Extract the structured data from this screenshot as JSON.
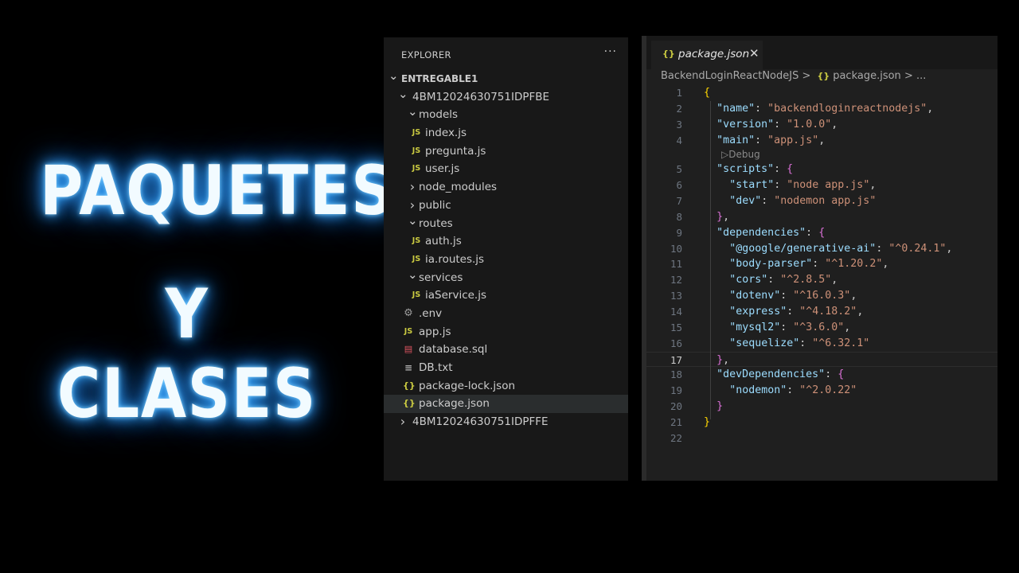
{
  "title": {
    "line1": "PAQUETES",
    "line2": "Y CLASES"
  },
  "explorer": {
    "header": "EXPLORER",
    "more": "···",
    "items": [
      {
        "label": "ENTREGABLE1",
        "chevron": "down",
        "icon": "",
        "indent": 0,
        "bold": true
      },
      {
        "label": "4BM12024630751IDPFBE",
        "chevron": "down",
        "icon": "",
        "indent": 1
      },
      {
        "label": "models",
        "chevron": "down",
        "icon": "",
        "indent": 2
      },
      {
        "label": "index.js",
        "chevron": "",
        "icon": "js",
        "indent": 3
      },
      {
        "label": "pregunta.js",
        "chevron": "",
        "icon": "js",
        "indent": 3
      },
      {
        "label": "user.js",
        "chevron": "",
        "icon": "js",
        "indent": 3
      },
      {
        "label": "node_modules",
        "chevron": "right",
        "icon": "",
        "indent": 2
      },
      {
        "label": "public",
        "chevron": "right",
        "icon": "",
        "indent": 2
      },
      {
        "label": "routes",
        "chevron": "down",
        "icon": "",
        "indent": 2
      },
      {
        "label": "auth.js",
        "chevron": "",
        "icon": "js",
        "indent": 3
      },
      {
        "label": "ia.routes.js",
        "chevron": "",
        "icon": "js",
        "indent": 3
      },
      {
        "label": "services",
        "chevron": "down",
        "icon": "",
        "indent": 2
      },
      {
        "label": "iaService.js",
        "chevron": "",
        "icon": "js",
        "indent": 3
      },
      {
        "label": ".env",
        "chevron": "",
        "icon": "gear",
        "indent": 2
      },
      {
        "label": "app.js",
        "chevron": "",
        "icon": "js",
        "indent": 2
      },
      {
        "label": "database.sql",
        "chevron": "",
        "icon": "db",
        "indent": 2
      },
      {
        "label": "DB.txt",
        "chevron": "",
        "icon": "txt",
        "indent": 2
      },
      {
        "label": "package-lock.json",
        "chevron": "",
        "icon": "json",
        "indent": 2
      },
      {
        "label": "package.json",
        "chevron": "",
        "icon": "json",
        "indent": 2,
        "selected": true
      },
      {
        "label": "4BM12024630751IDPFFE",
        "chevron": "right",
        "icon": "",
        "indent": 1
      }
    ]
  },
  "editor": {
    "tab": {
      "icon": "{}",
      "label": "package.json",
      "close": "✕"
    },
    "breadcrumb": {
      "folder": "BackendLoginReactNodeJS",
      "sep": ">",
      "icon": "{}",
      "file": "package.json",
      "tail": "> ..."
    },
    "codelens": "▷Debug",
    "current_line": 17,
    "lines": [
      {
        "n": "1",
        "indent": 0,
        "tokens": [
          [
            "b1",
            "{"
          ]
        ]
      },
      {
        "n": "2",
        "indent": 1,
        "tokens": [
          [
            "k",
            "\"name\""
          ],
          [
            "p",
            ": "
          ],
          [
            "s",
            "\"backendloginreactnodejs\""
          ],
          [
            "p",
            ","
          ]
        ]
      },
      {
        "n": "3",
        "indent": 1,
        "tokens": [
          [
            "k",
            "\"version\""
          ],
          [
            "p",
            ": "
          ],
          [
            "s",
            "\"1.0.0\""
          ],
          [
            "p",
            ","
          ]
        ]
      },
      {
        "n": "4",
        "indent": 1,
        "tokens": [
          [
            "k",
            "\"main\""
          ],
          [
            "p",
            ": "
          ],
          [
            "s",
            "\"app.js\""
          ],
          [
            "p",
            ","
          ]
        ],
        "lens_after": true
      },
      {
        "n": "5",
        "indent": 1,
        "tokens": [
          [
            "k",
            "\"scripts\""
          ],
          [
            "p",
            ": "
          ],
          [
            "b2",
            "{"
          ]
        ]
      },
      {
        "n": "6",
        "indent": 2,
        "tokens": [
          [
            "k",
            "\"start\""
          ],
          [
            "p",
            ": "
          ],
          [
            "s",
            "\"node app.js\""
          ],
          [
            "p",
            ","
          ]
        ]
      },
      {
        "n": "7",
        "indent": 2,
        "tokens": [
          [
            "k",
            "\"dev\""
          ],
          [
            "p",
            ": "
          ],
          [
            "s",
            "\"nodemon app.js\""
          ]
        ]
      },
      {
        "n": "8",
        "indent": 1,
        "tokens": [
          [
            "b2",
            "}"
          ],
          [
            "p",
            ","
          ]
        ]
      },
      {
        "n": "9",
        "indent": 1,
        "tokens": [
          [
            "k",
            "\"dependencies\""
          ],
          [
            "p",
            ": "
          ],
          [
            "b2",
            "{"
          ]
        ]
      },
      {
        "n": "10",
        "indent": 2,
        "tokens": [
          [
            "k",
            "\"@google/generative-ai\""
          ],
          [
            "p",
            ": "
          ],
          [
            "s",
            "\"^0.24.1\""
          ],
          [
            "p",
            ","
          ]
        ]
      },
      {
        "n": "11",
        "indent": 2,
        "tokens": [
          [
            "k",
            "\"body-parser\""
          ],
          [
            "p",
            ": "
          ],
          [
            "s",
            "\"^1.20.2\""
          ],
          [
            "p",
            ","
          ]
        ]
      },
      {
        "n": "12",
        "indent": 2,
        "tokens": [
          [
            "k",
            "\"cors\""
          ],
          [
            "p",
            ": "
          ],
          [
            "s",
            "\"^2.8.5\""
          ],
          [
            "p",
            ","
          ]
        ]
      },
      {
        "n": "13",
        "indent": 2,
        "tokens": [
          [
            "k",
            "\"dotenv\""
          ],
          [
            "p",
            ": "
          ],
          [
            "s",
            "\"^16.0.3\""
          ],
          [
            "p",
            ","
          ]
        ]
      },
      {
        "n": "14",
        "indent": 2,
        "tokens": [
          [
            "k",
            "\"express\""
          ],
          [
            "p",
            ": "
          ],
          [
            "s",
            "\"^4.18.2\""
          ],
          [
            "p",
            ","
          ]
        ]
      },
      {
        "n": "15",
        "indent": 2,
        "tokens": [
          [
            "k",
            "\"mysql2\""
          ],
          [
            "p",
            ": "
          ],
          [
            "s",
            "\"^3.6.0\""
          ],
          [
            "p",
            ","
          ]
        ]
      },
      {
        "n": "16",
        "indent": 2,
        "tokens": [
          [
            "k",
            "\"sequelize\""
          ],
          [
            "p",
            ": "
          ],
          [
            "s",
            "\"^6.32.1\""
          ]
        ]
      },
      {
        "n": "17",
        "indent": 1,
        "tokens": [
          [
            "b2",
            "}"
          ],
          [
            "p",
            ","
          ]
        ]
      },
      {
        "n": "18",
        "indent": 1,
        "tokens": [
          [
            "k",
            "\"devDependencies\""
          ],
          [
            "p",
            ": "
          ],
          [
            "b2",
            "{"
          ]
        ]
      },
      {
        "n": "19",
        "indent": 2,
        "tokens": [
          [
            "k",
            "\"nodemon\""
          ],
          [
            "p",
            ": "
          ],
          [
            "s",
            "\"^2.0.22\""
          ]
        ]
      },
      {
        "n": "20",
        "indent": 1,
        "tokens": [
          [
            "b2",
            "}"
          ]
        ]
      },
      {
        "n": "21",
        "indent": 0,
        "tokens": [
          [
            "b1",
            "}"
          ]
        ]
      },
      {
        "n": "22",
        "indent": 0,
        "tokens": []
      }
    ]
  }
}
